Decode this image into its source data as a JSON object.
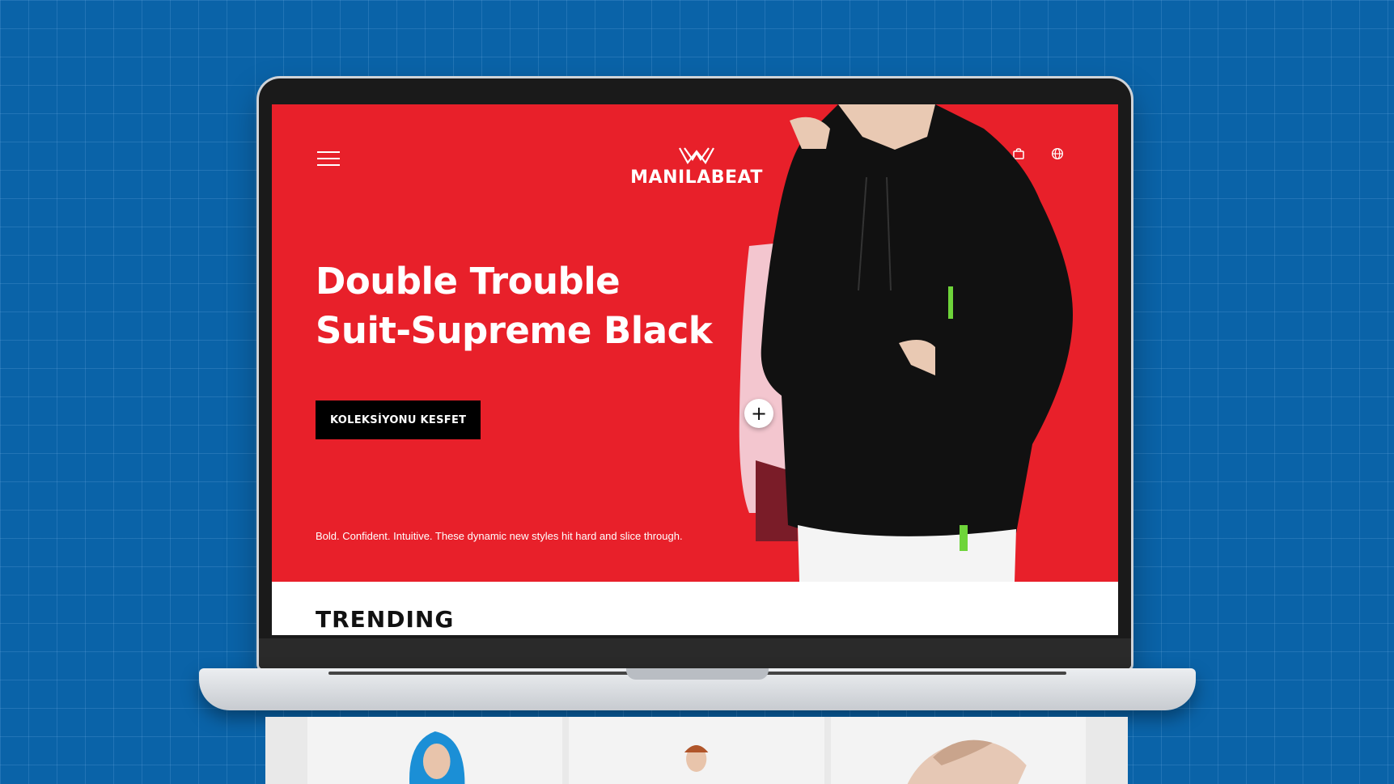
{
  "brand": {
    "name": "MANILABEAT",
    "accent_color": "#e8202a",
    "background_color": "#0a63a8"
  },
  "header": {
    "menu_icon": "hamburger-icon",
    "icons": [
      "search-icon",
      "user-icon",
      "heart-icon",
      "bag-icon",
      "globe-icon"
    ]
  },
  "hero": {
    "headline_line1": "Double Trouble",
    "headline_line2": "Suit-Supreme Black",
    "cta_label": "KOLEKSİYONU KESFET",
    "tagline": "Bold. Confident. Intuitive. These dynamic new styles hit hard and slice through.",
    "hotspot_label": "+"
  },
  "sections": {
    "trending_title": "TRENDING"
  }
}
